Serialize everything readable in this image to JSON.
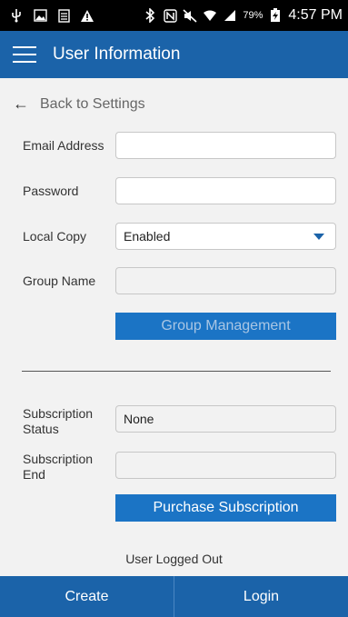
{
  "statusbar": {
    "battery_pct": "79%",
    "time": "4:57 PM"
  },
  "appbar": {
    "title": "User Information"
  },
  "nav": {
    "back_label": "Back to Settings"
  },
  "form": {
    "email_label": "Email Address",
    "email_value": "",
    "password_label": "Password",
    "password_value": "",
    "local_copy_label": "Local Copy",
    "local_copy_selected": "Enabled",
    "group_name_label": "Group Name",
    "group_name_value": "",
    "group_management_button": "Group Management",
    "subscription_status_label": "Subscription Status",
    "subscription_status_value": "None",
    "subscription_end_label": "Subscription End",
    "subscription_end_value": "",
    "purchase_button": "Purchase Subscription"
  },
  "status_message": "User Logged Out",
  "bottom": {
    "create_label": "Create",
    "login_label": "Login"
  },
  "colors": {
    "primary": "#1b63a9",
    "button": "#1b74c5"
  }
}
